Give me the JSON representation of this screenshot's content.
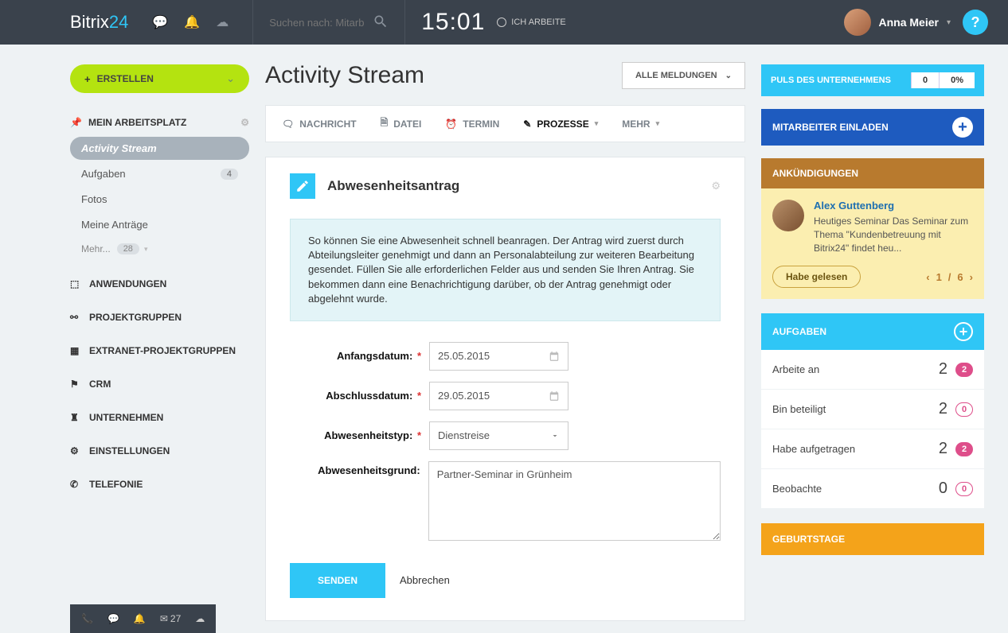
{
  "brand": {
    "main": "Bitrix",
    "accent": "24"
  },
  "search": {
    "placeholder": "Suchen nach: Mitarbe"
  },
  "time": "15:01",
  "work_status": "ICH ARBEITE",
  "user_name": "Anna Meier",
  "help_label": "?",
  "create_button": "ERSTELLEN",
  "sidebar": {
    "workspace_heading": "MEIN ARBEITSPLATZ",
    "items": [
      {
        "label": "Activity Stream",
        "active": true
      },
      {
        "label": "Aufgaben",
        "badge": "4"
      },
      {
        "label": "Fotos"
      },
      {
        "label": "Meine Anträge"
      }
    ],
    "more": {
      "label": "Mehr...",
      "badge": "28"
    },
    "nav": [
      {
        "label": "ANWENDUNGEN"
      },
      {
        "label": "PROJEKTGRUPPEN"
      },
      {
        "label": "EXTRANET-PROJEKTGRUPPEN"
      },
      {
        "label": "CRM"
      },
      {
        "label": "UNTERNEHMEN"
      },
      {
        "label": "EINSTELLUNGEN"
      },
      {
        "label": "TELEFONIE"
      }
    ]
  },
  "page_title": "Activity Stream",
  "filter_button": "ALLE MELDUNGEN",
  "tabs": [
    {
      "label": "NACHRICHT"
    },
    {
      "label": "DATEI"
    },
    {
      "label": "TERMIN"
    },
    {
      "label": "PROZESSE",
      "active": true,
      "dropdown": true
    },
    {
      "label": "MEHR",
      "dropdown": true
    }
  ],
  "card": {
    "title": "Abwesenheitsantrag",
    "info": "So können Sie eine Abwesenheit schnell beanragen. Der Antrag wird zuerst durch Abteilungsleiter genehmigt und dann an Personalabteilung zur weiteren Bearbeitung gesendet. Füllen Sie alle erforderlichen Felder aus und senden Sie Ihren Antrag. Sie bekommen dann eine Benachrichtigung darüber, ob der Antrag genehmigt oder abgelehnt wurde.",
    "fields": {
      "start_label": "Anfangsdatum:",
      "start_value": "25.05.2015",
      "end_label": "Abschlussdatum:",
      "end_value": "29.05.2015",
      "type_label": "Abwesenheitstyp:",
      "type_value": "Dienstreise",
      "reason_label": "Abwesenheitsgrund:",
      "reason_value": "Partner-Seminar in Grünheim"
    },
    "submit": "SENDEN",
    "cancel": "Abbrechen"
  },
  "right": {
    "pulse_title": "PULS DES UNTERNEHMENS",
    "pulse_count": "0",
    "pulse_pct": "0%",
    "invite": "MITARBEITER EINLADEN",
    "announce_head": "ANKÜNDIGUNGEN",
    "announce": {
      "name": "Alex Guttenberg",
      "text": "Heutiges Seminar Das Seminar zum Thema \"Kundenbetreuung mit Bitrix24\" findet heu...",
      "read_btn": "Habe gelesen",
      "page_cur": "1",
      "page_sep": "/",
      "page_total": "6"
    },
    "tasks_head": "AUFGABEN",
    "tasks": [
      {
        "label": "Arbeite an",
        "count": "2",
        "pill": "2",
        "filled": true
      },
      {
        "label": "Bin beteiligt",
        "count": "2",
        "pill": "0",
        "filled": false
      },
      {
        "label": "Habe aufgetragen",
        "count": "2",
        "pill": "2",
        "filled": true
      },
      {
        "label": "Beobachte",
        "count": "0",
        "pill": "0",
        "filled": false
      }
    ],
    "birthdays": "GEBURTSTAGE"
  },
  "bottombar": {
    "mail_count": "27"
  }
}
